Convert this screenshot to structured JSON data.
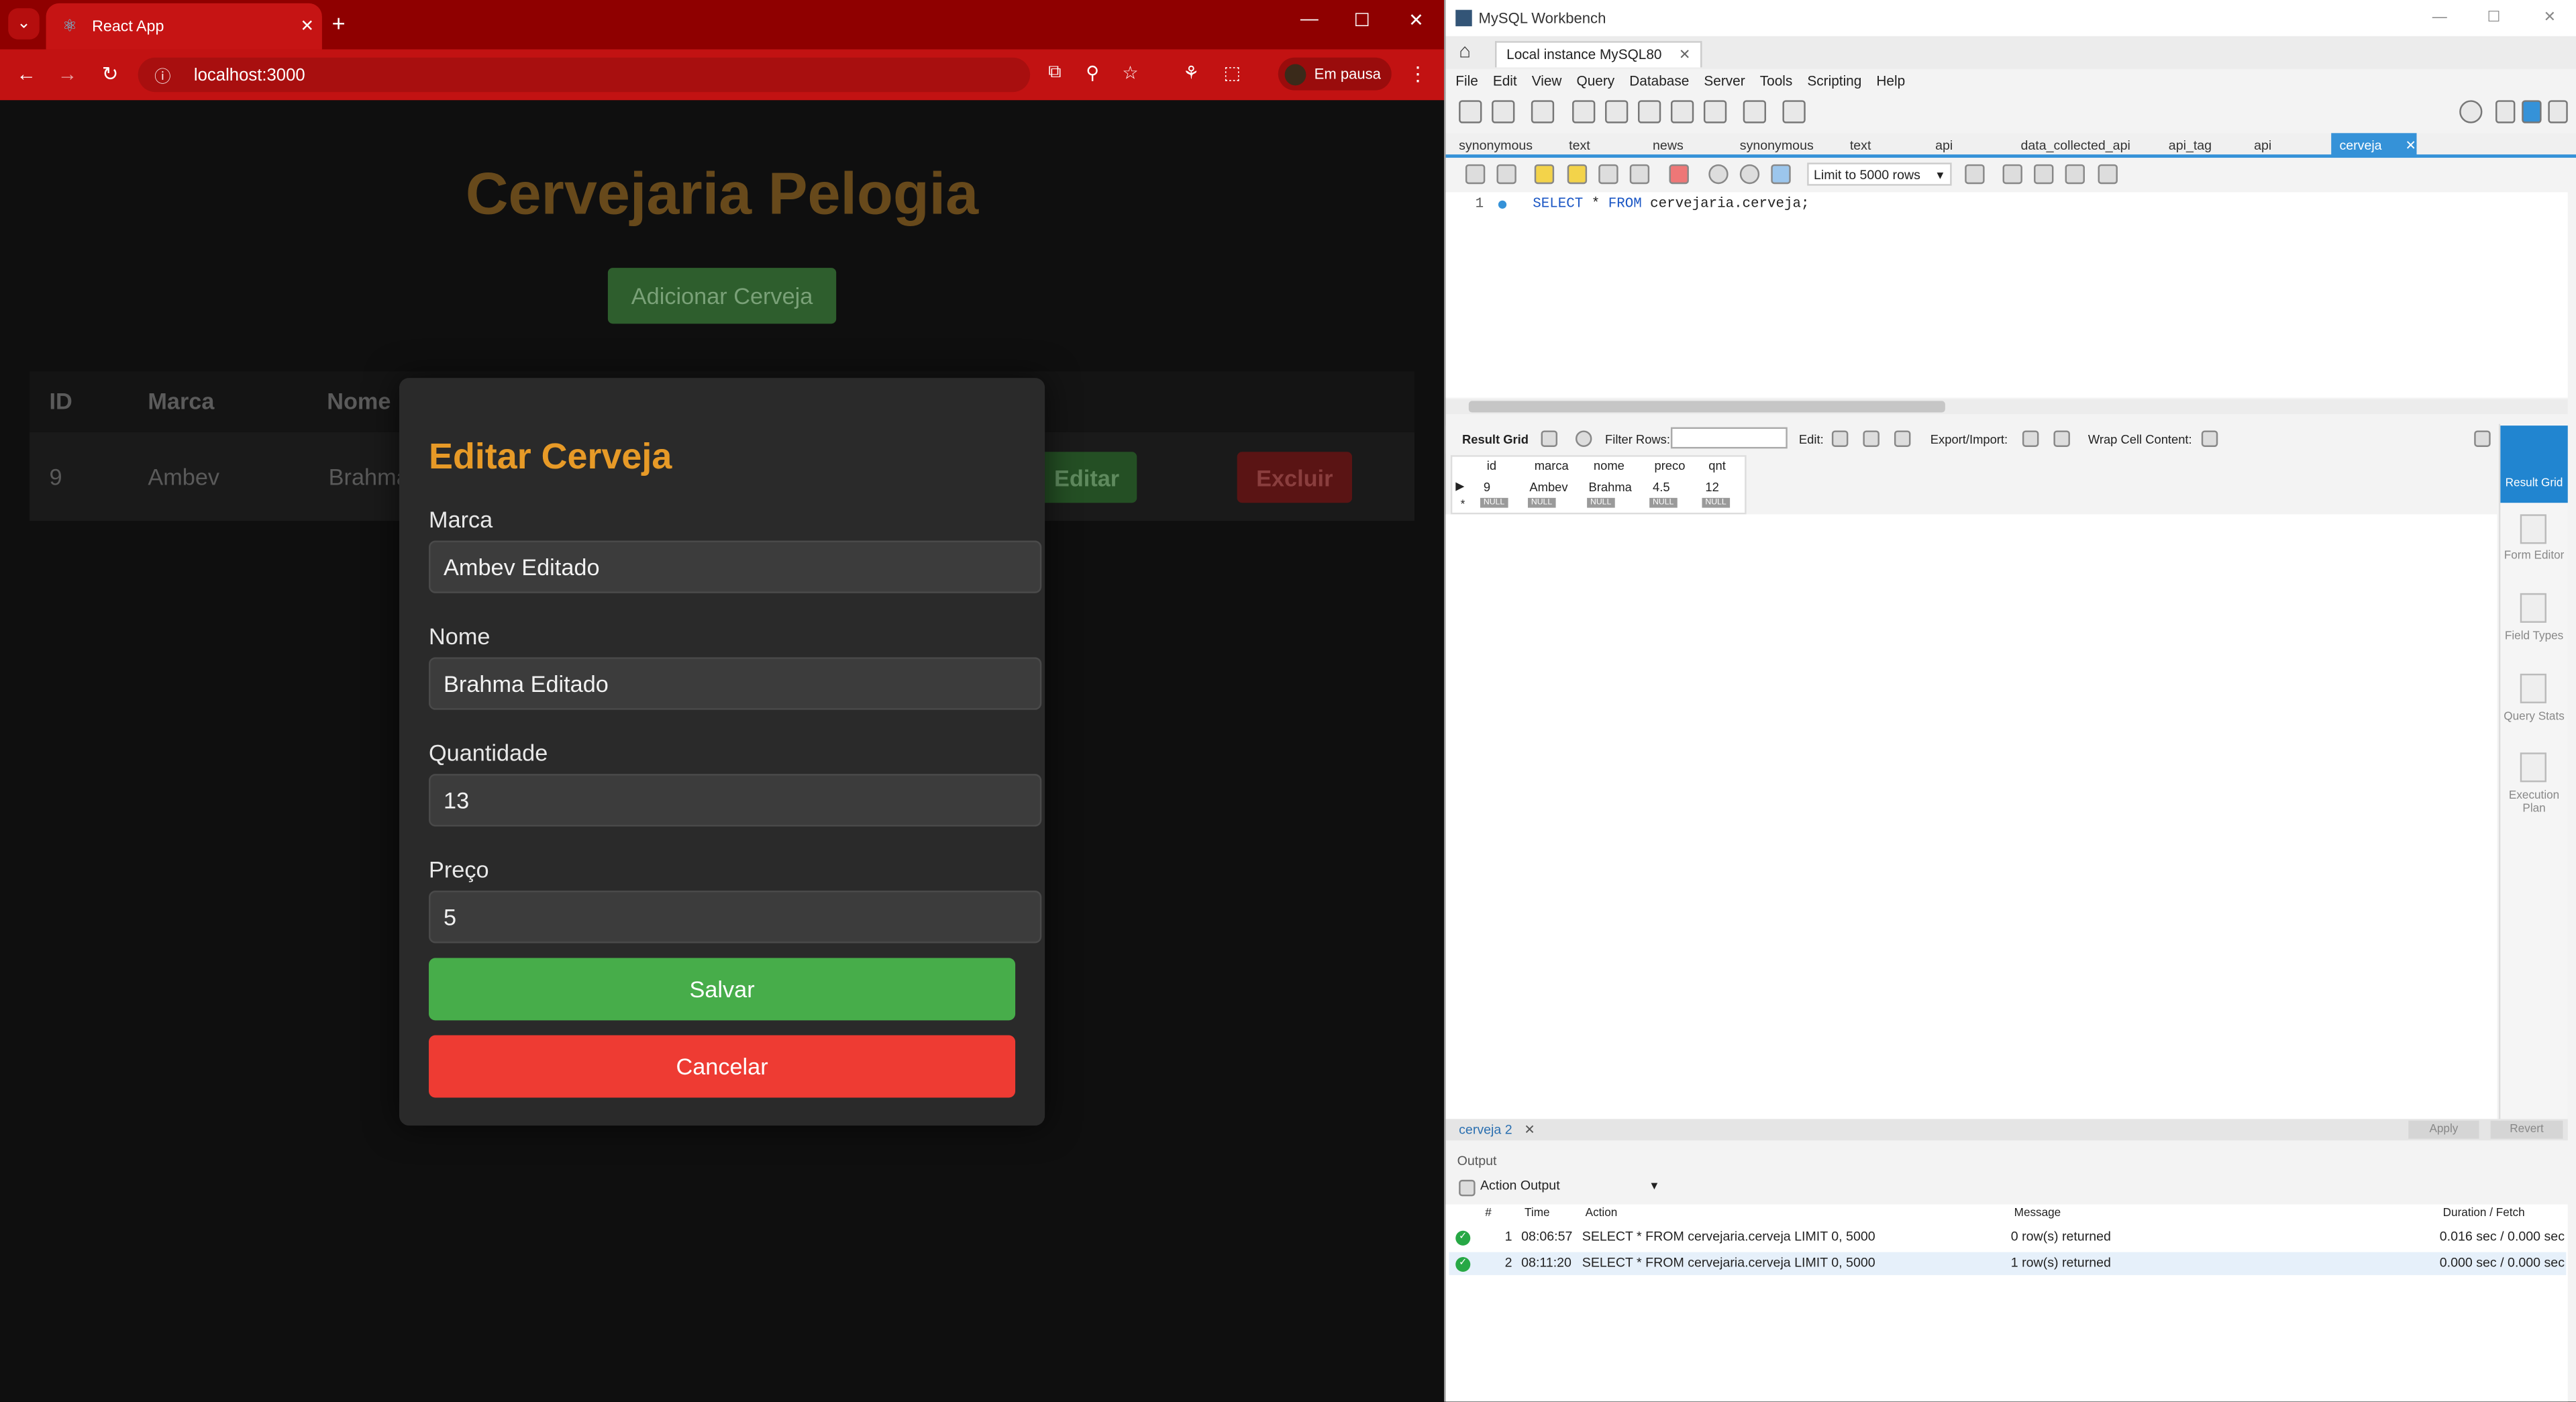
{
  "browser": {
    "tab_title": "React App",
    "url": "localhost:3000",
    "profile_label": "Em pausa"
  },
  "app": {
    "title": "Cervejaria Pelogia",
    "add_button": "Adicionar Cerveja",
    "table": {
      "headers": [
        "ID",
        "Marca",
        "Nome"
      ],
      "rows": [
        {
          "id": "9",
          "marca": "Ambev",
          "nome": "Brahma",
          "edit": "Editar",
          "delete": "Excluir"
        }
      ]
    }
  },
  "modal": {
    "title": "Editar Cerveja",
    "fields": [
      {
        "label": "Marca",
        "value": "Ambev Editado"
      },
      {
        "label": "Nome",
        "value": "Brahma Editado"
      },
      {
        "label": "Quantidade",
        "value": "13"
      },
      {
        "label": "Preço",
        "value": "5"
      }
    ],
    "save": "Salvar",
    "cancel": "Cancelar"
  },
  "workbench": {
    "title": "MySQL Workbench",
    "connection_tab": "Local instance MySQL80",
    "menu": [
      "File",
      "Edit",
      "View",
      "Query",
      "Database",
      "Server",
      "Tools",
      "Scripting",
      "Help"
    ],
    "query_tabs": [
      "synonymous",
      "text",
      "news",
      "synonymous",
      "text",
      "api",
      "data_collected_api",
      "api_tag",
      "api"
    ],
    "active_tab": "cerveja",
    "limit": "Limit to 5000 rows",
    "line_number": "1",
    "sql_keyword1": "SELECT",
    "sql_rest1": " * ",
    "sql_keyword2": "FROM",
    "sql_rest2": " cervejaria.cerveja;",
    "result_grid_label": "Result Grid",
    "filter_label": "Filter Rows:",
    "edit_label": "Edit:",
    "export_label": "Export/Import:",
    "wrap_label": "Wrap Cell Content:",
    "grid_headers": [
      "id",
      "marca",
      "nome",
      "preco",
      "qnt"
    ],
    "grid_row": [
      "9",
      "Ambev",
      "Brahma",
      "4.5",
      "12"
    ],
    "null_label": "NULL",
    "side_panel": [
      "Result Grid",
      "Form Editor",
      "Field Types",
      "Query Stats",
      "Execution Plan"
    ],
    "result_tab": "cerveja 2",
    "apply": "Apply",
    "revert": "Revert",
    "output_label": "Output",
    "output_select": "Action Output",
    "output_headers": [
      "#",
      "Time",
      "Action",
      "Message",
      "Duration / Fetch"
    ],
    "output_rows": [
      {
        "n": "1",
        "time": "08:06:57",
        "action": "SELECT * FROM cervejaria.cerveja LIMIT 0, 5000",
        "message": "0 row(s) returned",
        "duration": "0.016 sec / 0.000 sec"
      },
      {
        "n": "2",
        "time": "08:11:20",
        "action": "SELECT * FROM cervejaria.cerveja LIMIT 0, 5000",
        "message": "1 row(s) returned",
        "duration": "0.000 sec / 0.000 sec"
      }
    ]
  }
}
